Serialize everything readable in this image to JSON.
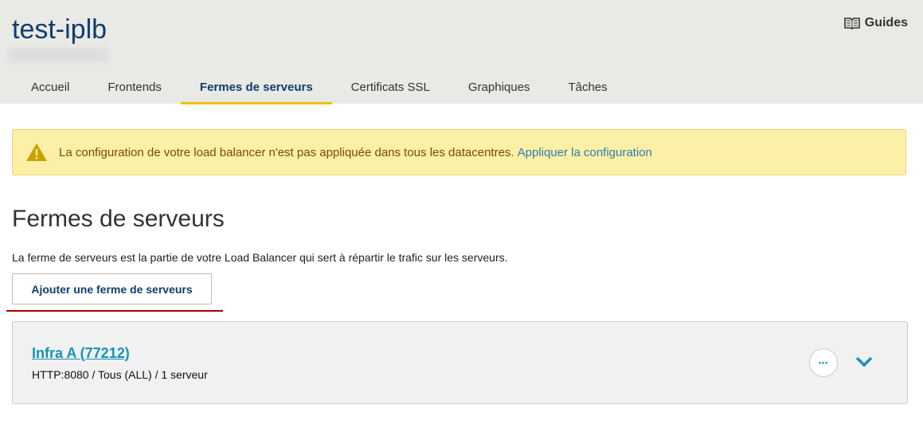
{
  "header": {
    "title": "test-iplb",
    "guides_label": "Guides"
  },
  "tabs": [
    {
      "label": "Accueil"
    },
    {
      "label": "Frontends"
    },
    {
      "label": "Fermes de serveurs"
    },
    {
      "label": "Certificats SSL"
    },
    {
      "label": "Graphiques"
    },
    {
      "label": "Tâches"
    }
  ],
  "alert": {
    "message": "La configuration de votre load balancer n'est pas appliquée dans tous les datacentres.",
    "link": "Appliquer la configuration"
  },
  "page": {
    "title": "Fermes de serveurs",
    "description": "La ferme de serveurs est la partie de votre Load Balancer qui sert à répartir le trafic sur les serveurs.",
    "add_button": "Ajouter une ferme de serveurs"
  },
  "farms": [
    {
      "name": "Infra A (77212)",
      "details": "HTTP:8080 / Tous (ALL) / 1 serveur",
      "more": "•••"
    }
  ]
}
